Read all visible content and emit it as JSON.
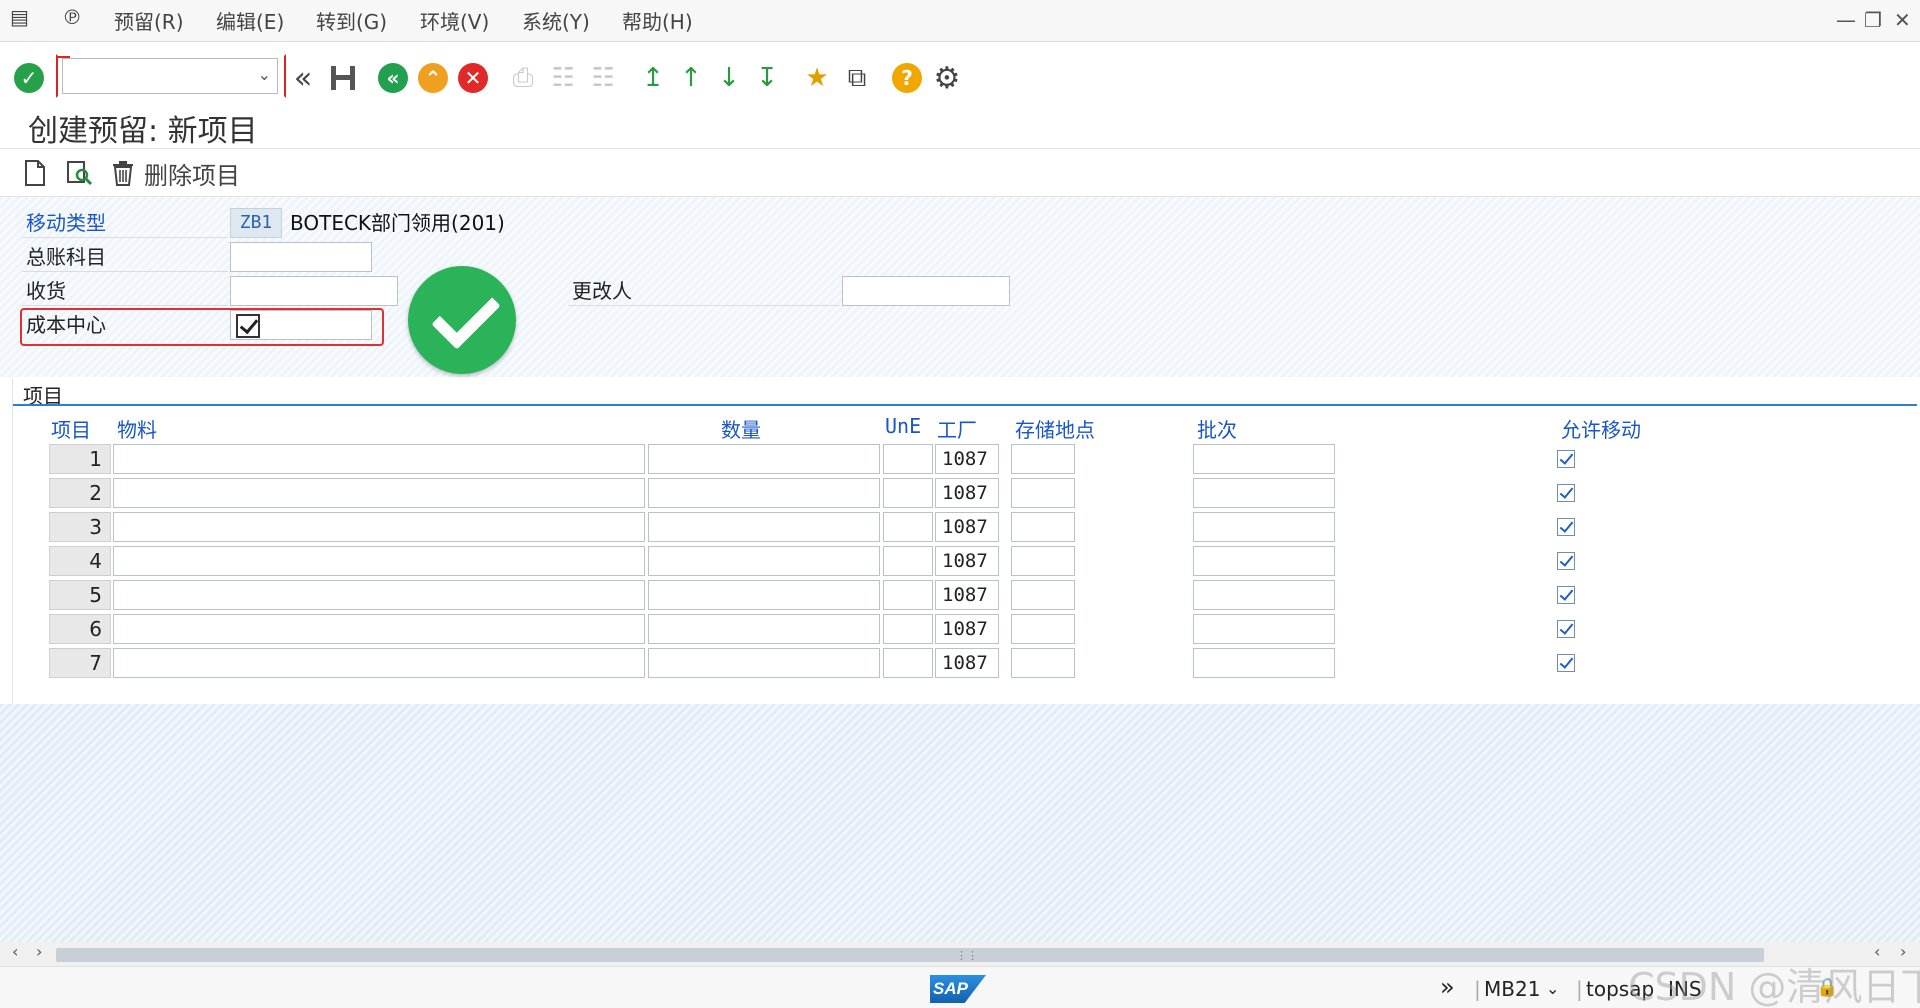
{
  "menu": {
    "items": [
      "预留(R)",
      "编辑(E)",
      "转到(G)",
      "环境(V)",
      "系统(Y)",
      "帮助(H)"
    ]
  },
  "title": "创建预留: 新项目",
  "app_toolbar": {
    "delete_item": "删除项目"
  },
  "header": {
    "movement_type_label": "移动类型",
    "movement_type_code": "ZB1",
    "movement_type_desc": "BOTECK部门领用(201)",
    "gl_account_label": "总账科目",
    "goods_recipient_label": "收货",
    "cost_center_label": "成本中心",
    "changed_by_label": "更改人"
  },
  "items": {
    "section_title": "项目",
    "columns": {
      "item": "项目",
      "material": "物料",
      "quantity": "数量",
      "une": "UnE",
      "plant": "工厂",
      "storage_location": "存储地点",
      "batch": "批次",
      "movement_allowed": "允许移动"
    },
    "rows": [
      {
        "num": "1",
        "plant": "1087"
      },
      {
        "num": "2",
        "plant": "1087"
      },
      {
        "num": "3",
        "plant": "1087"
      },
      {
        "num": "4",
        "plant": "1087"
      },
      {
        "num": "5",
        "plant": "1087"
      },
      {
        "num": "6",
        "plant": "1087"
      },
      {
        "num": "7",
        "plant": "1087"
      }
    ]
  },
  "status": {
    "transaction": "MB21",
    "user": "topsap",
    "mode": "INS"
  },
  "watermark": "CSDN @清风日下",
  "colors": {
    "accent_blue": "#1a56c8",
    "ok_green": "#2bb35a",
    "highlight_red": "#e03030"
  }
}
